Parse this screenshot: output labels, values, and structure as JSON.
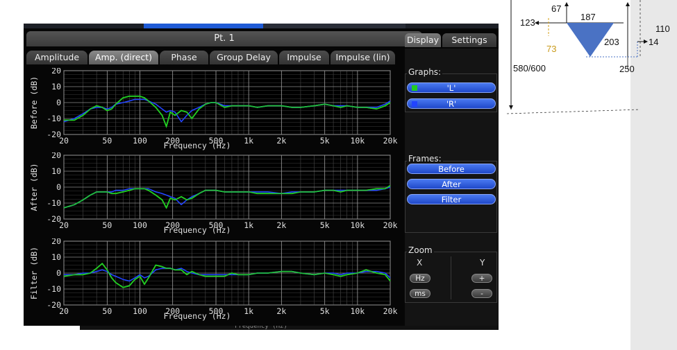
{
  "window": {
    "title": "Pt. 1",
    "tabs": [
      "Amplitude",
      "Amp. (direct)",
      "Phase",
      "Group Delay",
      "Impulse",
      "Impulse (lin)"
    ],
    "active_tab": "Amp. (direct)",
    "side_tabs": [
      "Display",
      "Settings"
    ],
    "active_side_tab": "Display",
    "partial_text": "Frequency (Hz)"
  },
  "sidebar": {
    "graphs_title": "Graphs:",
    "graphs": [
      {
        "label": "'L'",
        "color": "#22cc22"
      },
      {
        "label": "'R'",
        "color": "#2244ff"
      }
    ],
    "frames_title": "Frames:",
    "frames": [
      "Before",
      "After",
      "Filter"
    ],
    "zoom_title": "Zoom",
    "zoom_x_label": "X",
    "zoom_y_label": "Y",
    "zoom_x_buttons": [
      "Hz",
      "ms"
    ],
    "zoom_y_buttons": [
      "+",
      "-"
    ]
  },
  "chart_data": [
    {
      "type": "line",
      "ylabel": "Before (dB)",
      "xlabel": "Frequency (Hz)",
      "x_scale": "log",
      "xlim": [
        20,
        20000
      ],
      "ylim": [
        -20,
        20
      ],
      "x_ticks": [
        20,
        50,
        100,
        200,
        500,
        1000,
        2000,
        5000,
        10000,
        20000
      ],
      "x_tick_labels": [
        "20",
        "50",
        "100",
        "200",
        "500",
        "1k",
        "2k",
        "5k",
        "10k",
        "20k"
      ],
      "y_ticks": [
        -20,
        -10,
        0,
        10,
        20
      ],
      "y_tick_labels": [
        "-20",
        "-10",
        "0",
        "10",
        "20"
      ],
      "grid": true,
      "series": [
        {
          "name": "L",
          "color": "#22cc22",
          "x": [
            20,
            25,
            30,
            35,
            40,
            45,
            50,
            55,
            60,
            70,
            80,
            90,
            100,
            110,
            120,
            140,
            160,
            175,
            190,
            210,
            240,
            270,
            300,
            350,
            400,
            450,
            500,
            600,
            700,
            800,
            1000,
            1200,
            1500,
            2000,
            2500,
            3000,
            4000,
            5000,
            6000,
            7000,
            8000,
            10000,
            12000,
            15000,
            18000,
            20000
          ],
          "y": [
            -11,
            -11,
            -8,
            -4,
            -2,
            -3,
            -5,
            -4,
            -1,
            3,
            4,
            4,
            4,
            3,
            1,
            -3,
            -8,
            -15,
            -6,
            -8,
            -5,
            -6,
            -10,
            -4,
            -1,
            0,
            0,
            -3,
            -2,
            -2,
            -2,
            -3,
            -2,
            -2,
            -3,
            -3,
            -2,
            -1,
            -2,
            -3,
            -2,
            -3,
            -3,
            -4,
            -2,
            0
          ]
        },
        {
          "name": "R",
          "color": "#2244ff",
          "x": [
            20,
            25,
            30,
            35,
            40,
            45,
            50,
            55,
            60,
            70,
            80,
            90,
            100,
            110,
            120,
            140,
            160,
            175,
            190,
            210,
            240,
            270,
            300,
            350,
            400,
            450,
            500,
            600,
            700,
            800,
            1000,
            1200,
            1500,
            2000,
            2500,
            3000,
            4000,
            5000,
            6000,
            7000,
            8000,
            10000,
            12000,
            15000,
            18000,
            20000
          ],
          "y": [
            -12,
            -10,
            -7,
            -4,
            -3,
            -3,
            -4,
            -3,
            -1,
            0,
            1,
            2,
            2,
            2,
            1,
            -1,
            -4,
            -6,
            -5,
            -6,
            -12,
            -8,
            -5,
            -3,
            -1,
            0,
            0,
            -2,
            -2,
            -2,
            -2,
            -3,
            -2,
            -2,
            -3,
            -3,
            -2,
            -1,
            -2,
            -2,
            -2,
            -3,
            -3,
            -3,
            -1,
            1
          ]
        }
      ]
    },
    {
      "type": "line",
      "ylabel": "After (dB)",
      "xlabel": "Frequency (Hz)",
      "x_scale": "log",
      "xlim": [
        20,
        20000
      ],
      "ylim": [
        -20,
        20
      ],
      "x_ticks": [
        20,
        50,
        100,
        200,
        500,
        1000,
        2000,
        5000,
        10000,
        20000
      ],
      "x_tick_labels": [
        "20",
        "50",
        "100",
        "200",
        "500",
        "1k",
        "2k",
        "5k",
        "10k",
        "20k"
      ],
      "y_ticks": [
        -20,
        -10,
        0,
        10,
        20
      ],
      "y_tick_labels": [
        "-20",
        "-10",
        "0",
        "10",
        "20"
      ],
      "grid": true,
      "series": [
        {
          "name": "L",
          "color": "#22cc22",
          "x": [
            20,
            25,
            30,
            35,
            40,
            45,
            50,
            55,
            60,
            70,
            80,
            90,
            100,
            110,
            120,
            140,
            160,
            175,
            190,
            210,
            240,
            270,
            300,
            350,
            400,
            450,
            500,
            600,
            700,
            800,
            1000,
            1200,
            1500,
            2000,
            2500,
            3000,
            4000,
            5000,
            6000,
            7000,
            8000,
            10000,
            12000,
            15000,
            18000,
            20000
          ],
          "y": [
            -13,
            -11,
            -8,
            -5,
            -3,
            -3,
            -3,
            -4,
            -4,
            -3,
            -2,
            -1,
            -1,
            -1,
            -2,
            -5,
            -8,
            -13,
            -7,
            -8,
            -6,
            -8,
            -7,
            -4,
            -2,
            -2,
            -2,
            -3,
            -3,
            -3,
            -3,
            -4,
            -4,
            -4,
            -4,
            -3,
            -3,
            -2,
            -2,
            -3,
            -2,
            -2,
            -2,
            -1,
            -1,
            1
          ]
        },
        {
          "name": "R",
          "color": "#2244ff",
          "x": [
            20,
            25,
            30,
            35,
            40,
            45,
            50,
            55,
            60,
            70,
            80,
            90,
            100,
            110,
            120,
            140,
            160,
            175,
            190,
            210,
            240,
            270,
            300,
            350,
            400,
            450,
            500,
            600,
            700,
            800,
            1000,
            1200,
            1500,
            2000,
            2500,
            3000,
            4000,
            5000,
            6000,
            7000,
            8000,
            10000,
            12000,
            15000,
            18000,
            20000
          ],
          "y": [
            -13,
            -11,
            -8,
            -5,
            -3,
            -3,
            -3,
            -3,
            -2,
            -2,
            -1,
            -1,
            -1,
            -1,
            -1,
            -3,
            -4,
            -5,
            -6,
            -7,
            -11,
            -8,
            -6,
            -4,
            -2,
            -2,
            -2,
            -3,
            -3,
            -3,
            -3,
            -3,
            -3,
            -4,
            -3,
            -3,
            -3,
            -2,
            -2,
            -2,
            -2,
            -2,
            -2,
            -2,
            -1,
            0
          ]
        }
      ]
    },
    {
      "type": "line",
      "ylabel": "Filter (dB)",
      "xlabel": "Frequency (Hz)",
      "x_scale": "log",
      "xlim": [
        20,
        20000
      ],
      "ylim": [
        -20,
        20
      ],
      "x_ticks": [
        20,
        50,
        100,
        200,
        500,
        1000,
        2000,
        5000,
        10000,
        20000
      ],
      "x_tick_labels": [
        "20",
        "50",
        "100",
        "200",
        "500",
        "1k",
        "2k",
        "5k",
        "10k",
        "20k"
      ],
      "y_ticks": [
        -20,
        -10,
        0,
        10,
        20
      ],
      "y_tick_labels": [
        "-20",
        "-10",
        "0",
        "10",
        "20"
      ],
      "grid": true,
      "series": [
        {
          "name": "L",
          "color": "#22cc22",
          "x": [
            20,
            25,
            30,
            35,
            40,
            45,
            50,
            55,
            60,
            70,
            80,
            90,
            100,
            110,
            120,
            140,
            160,
            175,
            190,
            210,
            240,
            270,
            300,
            350,
            400,
            450,
            500,
            600,
            700,
            800,
            1000,
            1200,
            1500,
            2000,
            2500,
            3000,
            4000,
            5000,
            6000,
            7000,
            8000,
            10000,
            12000,
            15000,
            18000,
            20000
          ],
          "y": [
            -2,
            -1,
            -1,
            0,
            3,
            6,
            2,
            -3,
            -6,
            -9,
            -8,
            -4,
            -2,
            -7,
            -3,
            5,
            4,
            3,
            3,
            2,
            2,
            -1,
            1,
            -1,
            -2,
            -2,
            -2,
            -2,
            0,
            -1,
            -1,
            0,
            0,
            1,
            1,
            0,
            -1,
            0,
            -1,
            -2,
            -1,
            0,
            2,
            0,
            -1,
            -5
          ]
        },
        {
          "name": "R",
          "color": "#2244ff",
          "x": [
            20,
            25,
            30,
            35,
            40,
            45,
            50,
            55,
            60,
            70,
            80,
            90,
            100,
            110,
            120,
            140,
            160,
            175,
            190,
            210,
            240,
            270,
            300,
            350,
            400,
            450,
            500,
            600,
            700,
            800,
            1000,
            1200,
            1500,
            2000,
            2500,
            3000,
            4000,
            5000,
            6000,
            7000,
            8000,
            10000,
            12000,
            15000,
            18000,
            20000
          ],
          "y": [
            -1,
            -1,
            0,
            0,
            1,
            2,
            1,
            -1,
            -2,
            -4,
            -5,
            -3,
            -1,
            -3,
            -2,
            2,
            3,
            3,
            3,
            2,
            3,
            1,
            0,
            -1,
            -1,
            -1,
            -1,
            -1,
            -1,
            -1,
            -1,
            0,
            0,
            1,
            1,
            0,
            -1,
            0,
            0,
            -1,
            0,
            0,
            1,
            1,
            0,
            -3
          ]
        }
      ]
    }
  ],
  "annotation": {
    "labels": [
      "67",
      "187",
      "123",
      "110",
      "73",
      "203",
      "14",
      "580/600",
      "250"
    ],
    "label_73_color": "#c99a1a",
    "triangle_color": "#4a72c4"
  }
}
